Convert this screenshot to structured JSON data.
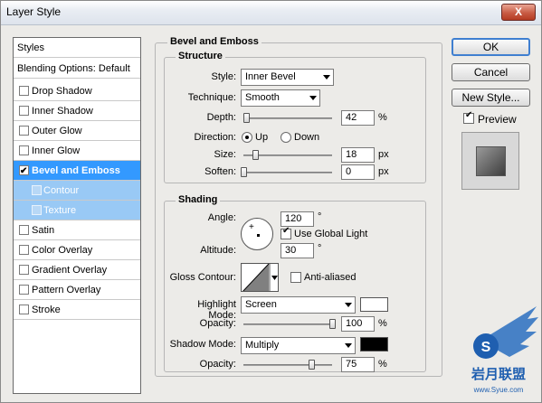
{
  "window": {
    "title": "Layer Style",
    "close_label": "X"
  },
  "styles_panel": {
    "header": "Styles",
    "blending": "Blending Options: Default",
    "items": [
      {
        "label": "Drop Shadow",
        "checked": false
      },
      {
        "label": "Inner Shadow",
        "checked": false
      },
      {
        "label": "Outer Glow",
        "checked": false
      },
      {
        "label": "Inner Glow",
        "checked": false
      },
      {
        "label": "Bevel and Emboss",
        "checked": true
      },
      {
        "label": "Contour",
        "checked": false
      },
      {
        "label": "Texture",
        "checked": false
      },
      {
        "label": "Satin",
        "checked": false
      },
      {
        "label": "Color Overlay",
        "checked": false
      },
      {
        "label": "Gradient Overlay",
        "checked": false
      },
      {
        "label": "Pattern Overlay",
        "checked": false
      },
      {
        "label": "Stroke",
        "checked": false
      }
    ]
  },
  "bevel": {
    "title": "Bevel and Emboss",
    "structure": {
      "title": "Structure",
      "style_label": "Style:",
      "style_value": "Inner Bevel",
      "technique_label": "Technique:",
      "technique_value": "Smooth",
      "depth_label": "Depth:",
      "depth_value": "42",
      "depth_unit": "%",
      "direction_label": "Direction:",
      "dir_up": "Up",
      "dir_down": "Down",
      "size_label": "Size:",
      "size_value": "18",
      "size_unit": "px",
      "soften_label": "Soften:",
      "soften_value": "0",
      "soften_unit": "px"
    },
    "shading": {
      "title": "Shading",
      "angle_label": "Angle:",
      "angle_value": "120",
      "angle_unit": "°",
      "global_light": "Use Global Light",
      "altitude_label": "Altitude:",
      "altitude_value": "30",
      "altitude_unit": "°",
      "gloss_label": "Gloss Contour:",
      "anti_aliased": "Anti-aliased",
      "highlight_label": "Highlight Mode:",
      "highlight_value": "Screen",
      "highlight_color": "#ffffff",
      "h_opacity_label": "Opacity:",
      "h_opacity_value": "100",
      "h_opacity_unit": "%",
      "shadow_label": "Shadow Mode:",
      "shadow_value": "Multiply",
      "shadow_color": "#000000",
      "s_opacity_label": "Opacity:",
      "s_opacity_value": "75",
      "s_opacity_unit": "%"
    }
  },
  "buttons": {
    "ok": "OK",
    "cancel": "Cancel",
    "new_style": "New Style...",
    "preview": "Preview"
  },
  "watermark": {
    "text": "岩月联盟",
    "url_text": "www.Syue.com",
    "badge": "S"
  }
}
